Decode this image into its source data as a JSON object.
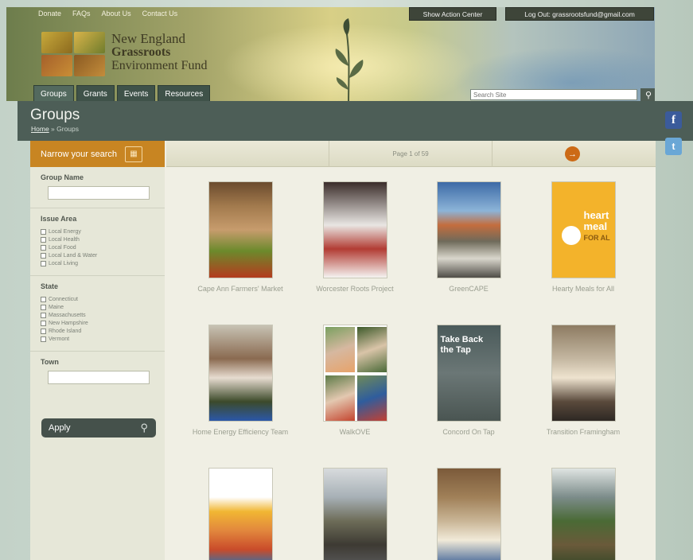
{
  "topnav": [
    "Donate",
    "FAQs",
    "About Us",
    "Contact Us"
  ],
  "account": {
    "show_action_center": "Show Action Center",
    "logout": "Log Out: grassrootsfund@gmail.com"
  },
  "logo": {
    "line1": "New England",
    "line2": "Grassroots",
    "line3": "Environment Fund"
  },
  "mainnav": [
    "Groups",
    "Grants",
    "Events",
    "Resources"
  ],
  "search": {
    "placeholder": "Search Site",
    "button_icon": "search-icon"
  },
  "page": {
    "title": "Groups",
    "breadcrumb_home": "Home",
    "breadcrumb_sep": " » ",
    "breadcrumb_current": "Groups"
  },
  "social": {
    "facebook": "f",
    "twitter": "t"
  },
  "sidebar": {
    "narrow_label": "Narrow your search",
    "group_name_label": "Group Name",
    "issue_area_label": "Issue Area",
    "issue_areas": [
      "Local Energy",
      "Local Health",
      "Local Food",
      "Local Land & Water",
      "Local Living"
    ],
    "state_label": "State",
    "states": [
      "Connecticut",
      "Maine",
      "Massachusetts",
      "New Hampshire",
      "Rhode Island",
      "Vermont"
    ],
    "town_label": "Town",
    "apply_label": "Apply"
  },
  "pager": {
    "text": "Page 1 of 59",
    "next_icon": "→"
  },
  "groups": [
    {
      "caption": "Cape Ann Farmers' Market"
    },
    {
      "caption": "Worcester Roots Project"
    },
    {
      "caption": "GreenCAPE"
    },
    {
      "caption": "Hearty Meals for All"
    },
    {
      "caption": "Home Energy Efficiency Team"
    },
    {
      "caption": "WalkOVE"
    },
    {
      "caption": "Concord On Tap"
    },
    {
      "caption": "Transition Framingham"
    },
    {
      "caption": ""
    },
    {
      "caption": ""
    },
    {
      "caption": ""
    },
    {
      "caption": ""
    }
  ],
  "hearty_thumb": {
    "line1": "heart",
    "line2": "meal",
    "line3": "FOR AL"
  },
  "tap_thumb": {
    "line1": "Take Back",
    "line2": "the Tap"
  },
  "colors": {
    "header_dark": "#4d5e57",
    "narrow_orange": "#c88522",
    "next_orange": "#cc6a16",
    "content_bg": "#f0efe4"
  }
}
